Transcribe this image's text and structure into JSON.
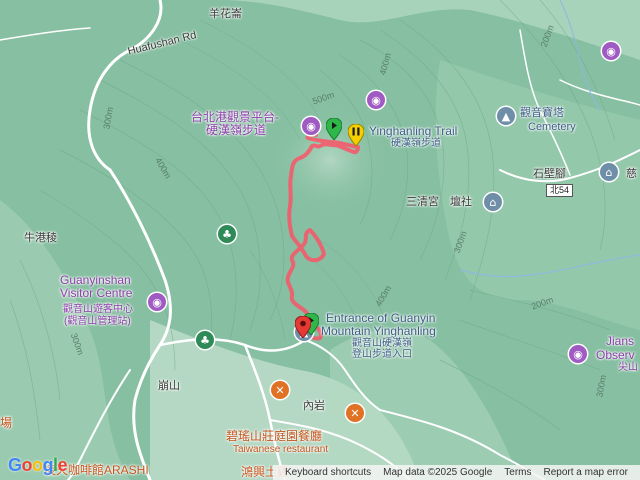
{
  "map": {
    "places": {
      "yanghuaqi": "羊花崙",
      "huafushan_rd": "Huafushan Rd",
      "niugangleng": "牛港稜",
      "guanyinshan_vc_en_1": "Guanyinshan",
      "guanyinshan_vc_en_2": "Visitor Centre",
      "guanyinshan_vc_zh_1": "觀音山遊客中心",
      "guanyinshan_vc_zh_2": "(觀音山管理站)",
      "taipei_port_view_1": "台北港觀景平台-",
      "taipei_port_view_2": "硬漢嶺步道",
      "yinghanling_trail": "Yinghanling Trail",
      "yinghanling_trail_zh": "硬漢嶺步道",
      "guanyin_pagoda": "觀音寶塔",
      "cemetery": "Cemetery",
      "shibijiao": "石壁腳",
      "sanqing_temple": "三清宮",
      "tanshe": "壇社",
      "entrance_en_1": "Entrance of Guanyin",
      "entrance_en_2": "Mountain Yinghanling",
      "entrance_zh_1": "觀音山硬漢嶺",
      "entrance_zh_2": "登山步道入口",
      "bengshan": "崩山",
      "neiyan": "內岩",
      "bilu_restaurant_zh": "碧瑤山莊庭園餐廳",
      "bilu_restaurant_en": "Taiwanese restaurant",
      "lingyun_cafe": "凌天咖啡館ARASHI",
      "hongxing_chicken": "鴻興土雞",
      "left_edge_chang": "場",
      "jians_1": "Jians",
      "jians_2": "Observ",
      "jians_zh": "尖山",
      "ci_right": "慈",
      "route_shield": "北54"
    },
    "contours": [
      "200m",
      "300m",
      "400m",
      "500m",
      "400m",
      "300m",
      "200m",
      "300m",
      "400m",
      "300m"
    ]
  },
  "attribution": {
    "keyboard": "Keyboard shortcuts",
    "mapdata": "Map data ©2025 Google",
    "terms": "Terms",
    "report": "Report a map error"
  },
  "logo": "Google",
  "markers": {
    "start_color": "#2fb84a",
    "end_color": "#e53935",
    "pause_color": "#f5d000",
    "track_color": "#f25c6c"
  }
}
